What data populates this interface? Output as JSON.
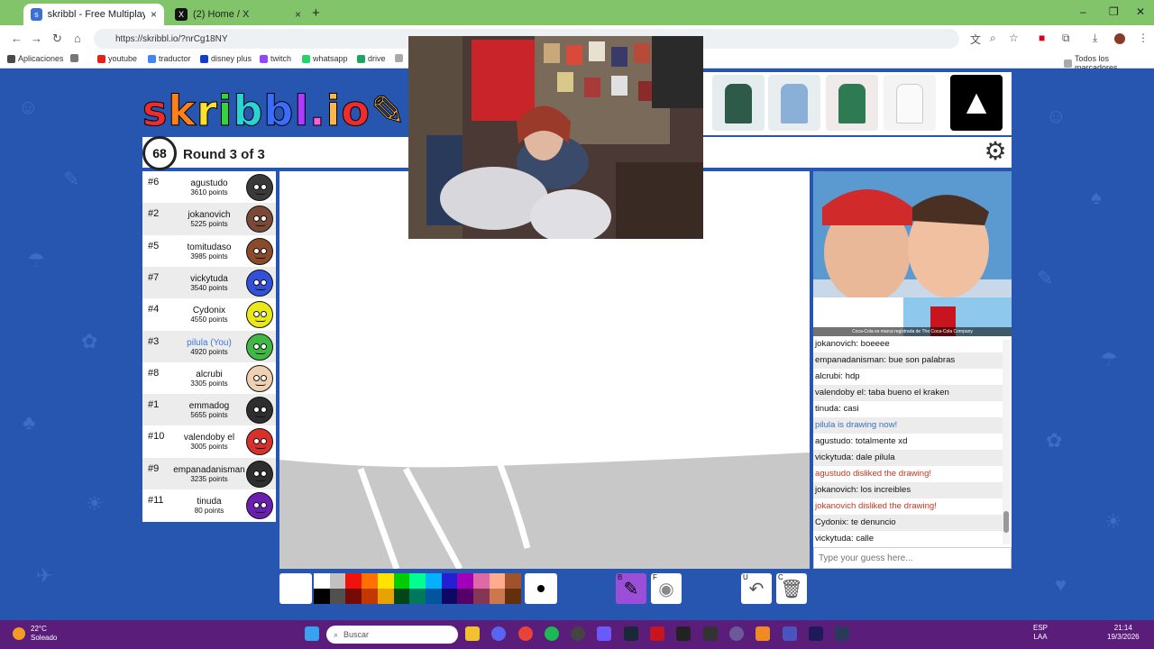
{
  "browser": {
    "tabs": [
      {
        "title": "skribbl - Free Multiplayer Draw",
        "active": true,
        "icon": "skribbl-icon"
      },
      {
        "title": "(2) Home / X",
        "active": false,
        "icon": "x-icon"
      }
    ],
    "new_tab": "+",
    "url": "https://skribbl.io/?nrCg18NY",
    "bookmarks": [
      {
        "label": "Aplicaciones",
        "color": "#4a4a4a"
      },
      {
        "label": "youtube",
        "color": "#e62117"
      },
      {
        "label": "traductor",
        "color": "#4285f4"
      },
      {
        "label": "disney plus",
        "color": "#113ccf"
      },
      {
        "label": "twitch",
        "color": "#9146ff"
      },
      {
        "label": "whatsapp",
        "color": "#25d366"
      },
      {
        "label": "drive",
        "color": "#1fa463"
      }
    ],
    "all_bookmarks": "Todos los marcadores"
  },
  "game": {
    "logo": "skribbl.io",
    "timer": "68",
    "round": "Round 3 of 3",
    "players": [
      {
        "rank": "#6",
        "name": "agustudo",
        "points": "3610 points",
        "color": "#3a3a3a"
      },
      {
        "rank": "#2",
        "name": "jokanovich",
        "points": "5225 points",
        "color": "#7a4a36"
      },
      {
        "rank": "#5",
        "name": "tomitudaso",
        "points": "3985 points",
        "color": "#8b4a2a"
      },
      {
        "rank": "#7",
        "name": "vickytuda",
        "points": "3540 points",
        "color": "#3350d8"
      },
      {
        "rank": "#4",
        "name": "Cydonix",
        "points": "4550 points",
        "color": "#e8e81a"
      },
      {
        "rank": "#3",
        "name": "pilula (You)",
        "points": "4920 points",
        "color": "#3fb846",
        "you": true
      },
      {
        "rank": "#8",
        "name": "alcrubi",
        "points": "3305 points",
        "color": "#f0d0b0"
      },
      {
        "rank": "#1",
        "name": "emmadog",
        "points": "5655 points",
        "color": "#2e2e2e"
      },
      {
        "rank": "#10",
        "name": "valendoby el",
        "points": "3005 points",
        "color": "#d8302a"
      },
      {
        "rank": "#9",
        "name": "empanadanisman",
        "points": "3235 points",
        "color": "#2e2e2e"
      },
      {
        "rank": "#11",
        "name": "tinuda",
        "points": "80 points",
        "color": "#6a1fb0"
      }
    ],
    "chat": [
      {
        "author": "jokanovich:",
        "text": "boeeee",
        "kind": "normal"
      },
      {
        "author": "empanadanisman:",
        "text": "bue son palabras",
        "kind": "normal"
      },
      {
        "author": "alcrubi:",
        "text": "hdp",
        "kind": "normal"
      },
      {
        "author": "valendoby el:",
        "text": "taba bueno el kraken",
        "kind": "normal"
      },
      {
        "author": "tinuda:",
        "text": "casi",
        "kind": "normal"
      },
      {
        "author": "",
        "text": "pilula is drawing now!",
        "kind": "sys-blue"
      },
      {
        "author": "agustudo:",
        "text": "totalmente xd",
        "kind": "normal"
      },
      {
        "author": "vickytuda:",
        "text": "dale pilula",
        "kind": "normal"
      },
      {
        "author": "",
        "text": "agustudo disliked the drawing!",
        "kind": "sys-red"
      },
      {
        "author": "jokanovich:",
        "text": "los increibles",
        "kind": "normal"
      },
      {
        "author": "",
        "text": "jokanovich disliked the drawing!",
        "kind": "sys-red"
      },
      {
        "author": "Cydonix:",
        "text": "te denuncio",
        "kind": "normal"
      },
      {
        "author": "vickytuda:",
        "text": "calle",
        "kind": "normal"
      }
    ],
    "chat_placeholder": "Type your guess here...",
    "palette_top": [
      "#ffffff",
      "#c1c1c1",
      "#ef130b",
      "#ff7100",
      "#ffe400",
      "#00cc00",
      "#00ff91",
      "#00b2ff",
      "#231fd3",
      "#a300ba",
      "#df69a7",
      "#ffac8e",
      "#a0522d"
    ],
    "palette_bottom": [
      "#000000",
      "#505050",
      "#740b07",
      "#c23800",
      "#e8a200",
      "#004619",
      "#00785d",
      "#00569e",
      "#0e0865",
      "#550069",
      "#873554",
      "#cc774d",
      "#63300d"
    ],
    "tools": [
      {
        "key": "B",
        "icon": "pencil-icon",
        "bg": "#9b4fd8"
      },
      {
        "key": "F",
        "icon": "fill-bucket-icon",
        "bg": "#ffffff"
      },
      {
        "key": "U",
        "icon": "undo-icon",
        "bg": "#ffffff"
      },
      {
        "key": "C",
        "icon": "trash-icon",
        "bg": "#ffffff"
      }
    ],
    "side_ad_caption": "Coca-Cola es marca registrada de The Coca-Cola Company"
  },
  "taskbar": {
    "temperature": "22°C",
    "weather": "Soleado",
    "search_placeholder": "Buscar",
    "lang": "ESP",
    "layout": "LAA",
    "time": "21:14",
    "date": "19/3/2026"
  }
}
